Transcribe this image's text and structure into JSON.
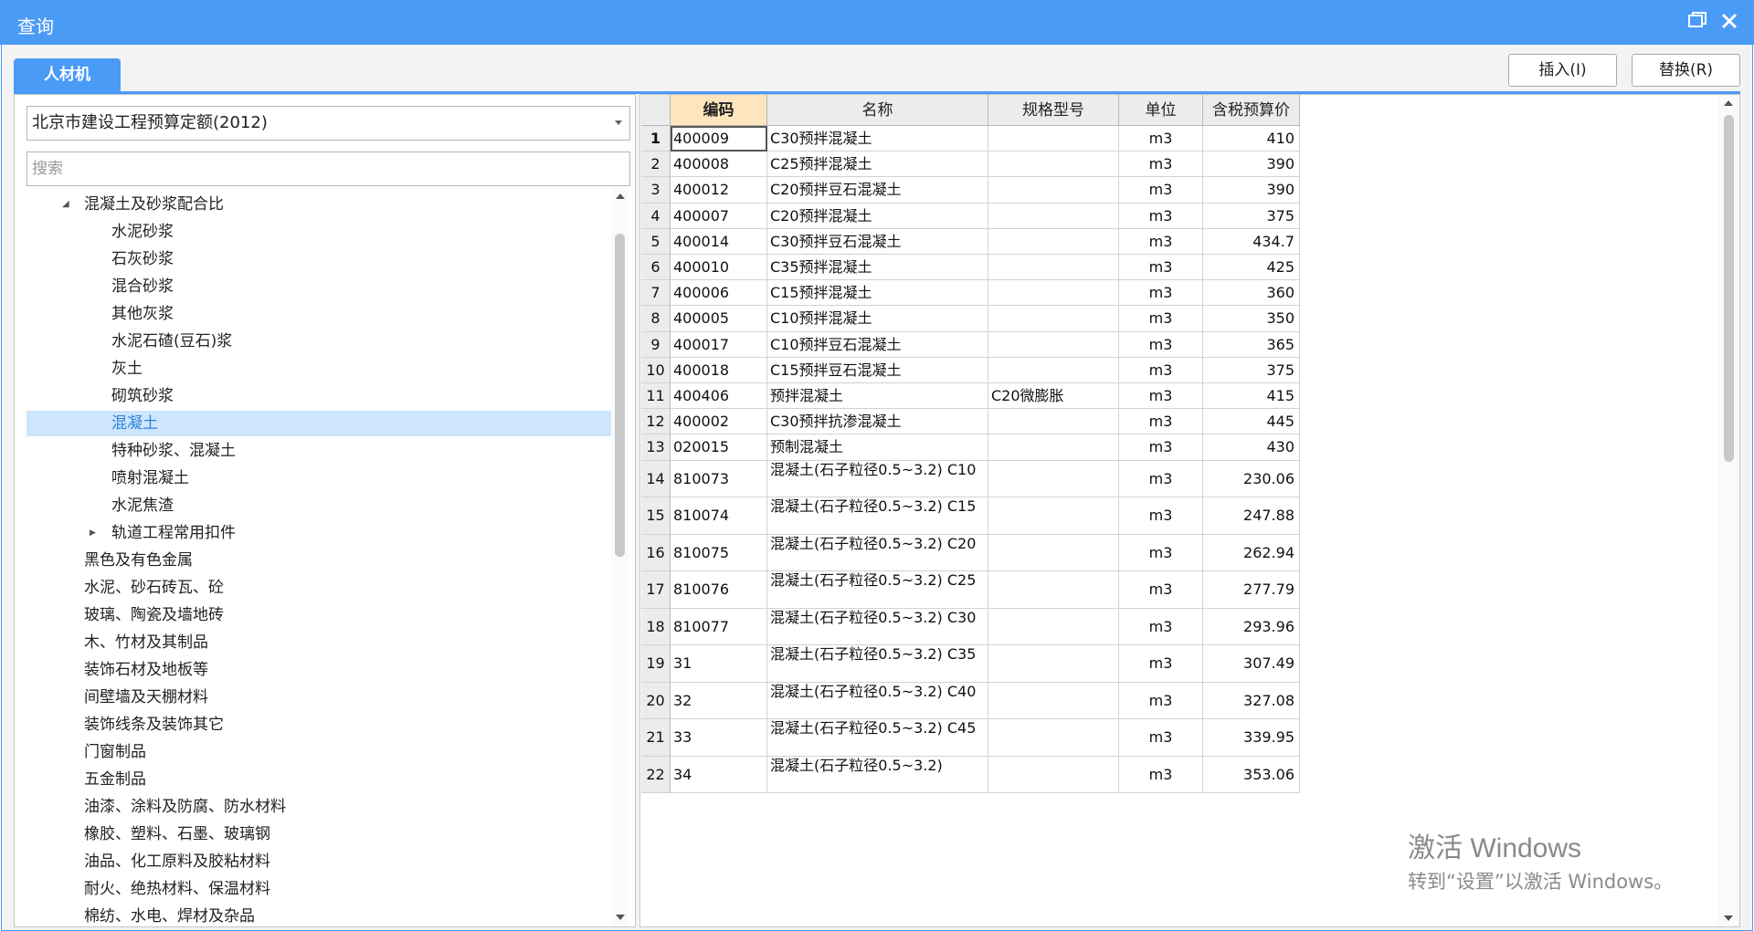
{
  "window": {
    "title": "查询"
  },
  "tabs": [
    {
      "label": "人材机",
      "active": true
    }
  ],
  "toolbar": {
    "insert_label": "插入(I)",
    "replace_label": "替换(R)"
  },
  "left": {
    "dataset_selected": "北京市建设工程预算定额(2012)",
    "search_placeholder": "搜索",
    "tree": [
      {
        "label": "混凝土及砂浆配合比",
        "level": 1,
        "expander": "expanded"
      },
      {
        "label": "水泥砂浆",
        "level": 2
      },
      {
        "label": "石灰砂浆",
        "level": 2
      },
      {
        "label": "混合砂浆",
        "level": 2
      },
      {
        "label": "其他灰浆",
        "level": 2
      },
      {
        "label": "水泥石碴(豆石)浆",
        "level": 2
      },
      {
        "label": "灰土",
        "level": 2
      },
      {
        "label": "砌筑砂浆",
        "level": 2
      },
      {
        "label": "混凝土",
        "level": 2,
        "selected": true
      },
      {
        "label": "特种砂浆、混凝土",
        "level": 2
      },
      {
        "label": "喷射混凝土",
        "level": 2
      },
      {
        "label": "水泥焦渣",
        "level": 2
      },
      {
        "label": "轨道工程常用扣件",
        "level": 2,
        "expander": "collapsed"
      },
      {
        "label": "黑色及有色金属",
        "level": 1
      },
      {
        "label": "水泥、砂石砖瓦、砼",
        "level": 1
      },
      {
        "label": "玻璃、陶瓷及墙地砖",
        "level": 1
      },
      {
        "label": "木、竹材及其制品",
        "level": 1
      },
      {
        "label": "装饰石材及地板等",
        "level": 1
      },
      {
        "label": "间壁墙及天棚材料",
        "level": 1
      },
      {
        "label": "装饰线条及装饰其它",
        "level": 1
      },
      {
        "label": "门窗制品",
        "level": 1
      },
      {
        "label": "五金制品",
        "level": 1
      },
      {
        "label": "油漆、涂料及防腐、防水材料",
        "level": 1
      },
      {
        "label": "橡胶、塑料、石墨、玻璃钢",
        "level": 1
      },
      {
        "label": "油品、化工原料及胶粘材料",
        "level": 1
      },
      {
        "label": "耐火、绝热材料、保温材料",
        "level": 1
      },
      {
        "label": "棉纺、水电、焊材及杂品",
        "level": 1
      }
    ]
  },
  "table": {
    "columns": [
      "编码",
      "名称",
      "规格型号",
      "单位",
      "含税预算价"
    ],
    "rows": [
      {
        "n": "1",
        "code": "400009",
        "name": "C30预拌混凝土",
        "spec": "",
        "unit": "m3",
        "price": "410"
      },
      {
        "n": "2",
        "code": "400008",
        "name": "C25预拌混凝土",
        "spec": "",
        "unit": "m3",
        "price": "390"
      },
      {
        "n": "3",
        "code": "400012",
        "name": "C20预拌豆石混凝土",
        "spec": "",
        "unit": "m3",
        "price": "390"
      },
      {
        "n": "4",
        "code": "400007",
        "name": "C20预拌混凝土",
        "spec": "",
        "unit": "m3",
        "price": "375"
      },
      {
        "n": "5",
        "code": "400014",
        "name": "C30预拌豆石混凝土",
        "spec": "",
        "unit": "m3",
        "price": "434.7"
      },
      {
        "n": "6",
        "code": "400010",
        "name": "C35预拌混凝土",
        "spec": "",
        "unit": "m3",
        "price": "425"
      },
      {
        "n": "7",
        "code": "400006",
        "name": "C15预拌混凝土",
        "spec": "",
        "unit": "m3",
        "price": "360"
      },
      {
        "n": "8",
        "code": "400005",
        "name": "C10预拌混凝土",
        "spec": "",
        "unit": "m3",
        "price": "350"
      },
      {
        "n": "9",
        "code": "400017",
        "name": "C10预拌豆石混凝土",
        "spec": "",
        "unit": "m3",
        "price": "365"
      },
      {
        "n": "10",
        "code": "400018",
        "name": "C15预拌豆石混凝土",
        "spec": "",
        "unit": "m3",
        "price": "375"
      },
      {
        "n": "11",
        "code": "400406",
        "name": "预拌混凝土",
        "spec": "C20微膨胀",
        "unit": "m3",
        "price": "415"
      },
      {
        "n": "12",
        "code": "400002",
        "name": "C30预拌抗渗混凝土",
        "spec": "",
        "unit": "m3",
        "price": "445"
      },
      {
        "n": "13",
        "code": "020015",
        "name": "预制混凝土",
        "spec": "",
        "unit": "m3",
        "price": "430"
      },
      {
        "n": "14",
        "code": "810073",
        "name": "混凝土(石子粒径0.5~3.2) C10",
        "spec": "",
        "unit": "m3",
        "price": "230.06"
      },
      {
        "n": "15",
        "code": "810074",
        "name": "混凝土(石子粒径0.5~3.2) C15",
        "spec": "",
        "unit": "m3",
        "price": "247.88"
      },
      {
        "n": "16",
        "code": "810075",
        "name": "混凝土(石子粒径0.5~3.2) C20",
        "spec": "",
        "unit": "m3",
        "price": "262.94"
      },
      {
        "n": "17",
        "code": "810076",
        "name": "混凝土(石子粒径0.5~3.2) C25",
        "spec": "",
        "unit": "m3",
        "price": "277.79"
      },
      {
        "n": "18",
        "code": "810077",
        "name": "混凝土(石子粒径0.5~3.2) C30",
        "spec": "",
        "unit": "m3",
        "price": "293.96"
      },
      {
        "n": "19",
        "code": "31",
        "name": "混凝土(石子粒径0.5~3.2) C35",
        "spec": "",
        "unit": "m3",
        "price": "307.49"
      },
      {
        "n": "20",
        "code": "32",
        "name": "混凝土(石子粒径0.5~3.2) C40",
        "spec": "",
        "unit": "m3",
        "price": "327.08"
      },
      {
        "n": "21",
        "code": "33",
        "name": "混凝土(石子粒径0.5~3.2) C45",
        "spec": "",
        "unit": "m3",
        "price": "339.95"
      },
      {
        "n": "22",
        "code": "34",
        "name": "混凝土(石子粒径0.5~3.2)",
        "spec": "",
        "unit": "m3",
        "price": "353.06"
      }
    ]
  },
  "watermark": {
    "line1": "激活 Windows",
    "line2": "转到“设置”以激活 Windows。"
  },
  "colors": {
    "accent": "#4a9bf5",
    "selected_bg": "#cde6fd",
    "header_code_bg": "#fde5c0"
  },
  "icons": {
    "restore": "restore-icon",
    "close": "close-icon",
    "expanded": "expanded-triangle-icon",
    "collapsed": "collapsed-triangle-icon"
  }
}
